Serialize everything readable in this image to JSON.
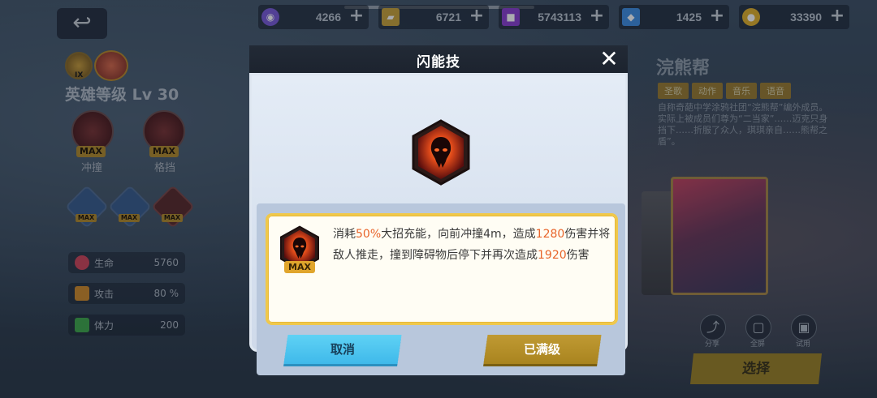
{
  "top_bar": {
    "resources": [
      {
        "icon": "purple-orb-icon",
        "value": "4266",
        "color": "#7a5bd8"
      },
      {
        "icon": "ticket-icon",
        "value": "6721",
        "color": "#c9a33a"
      },
      {
        "icon": "purple-cube-icon",
        "value": "5743113",
        "color": "#8a3fd0"
      },
      {
        "icon": "blue-gem-icon",
        "value": "1425",
        "color": "#3f8ee0"
      },
      {
        "icon": "gold-coin-icon",
        "value": "33390",
        "color": "#e0b02a"
      }
    ]
  },
  "left_panel": {
    "badge_rank": "IX",
    "hero_level": "英雄等级 Lv 30",
    "skills": [
      {
        "name": "冲撞",
        "badge": "MAX"
      },
      {
        "name": "格挡",
        "badge": "MAX"
      }
    ],
    "small_skills": [
      {
        "badge": "MAX"
      },
      {
        "badge": "MAX"
      },
      {
        "badge": "MAX"
      }
    ],
    "stats": [
      {
        "label": "生命",
        "value": "5760",
        "icon": "heart-icon",
        "color": "#d0455a"
      },
      {
        "label": "攻击",
        "value": "80 %",
        "icon": "burst-icon",
        "color": "#d08a2a"
      },
      {
        "label": "体力",
        "value": "200",
        "icon": "lightning-icon",
        "color": "#3fa84a"
      }
    ]
  },
  "right_panel": {
    "hero_name": "浣熊帮",
    "tags": [
      "圣歌",
      "动作",
      "音乐",
      "语音"
    ],
    "bio": "自称奇葩中学涂鸦社团“浣熊帮”编外成员。实际上被成员们尊为“二当家”……迈克只身挡下……折服了众人，琪琪亲自……熊帮之盾”。",
    "controls": [
      {
        "label": "分享",
        "icon": "share-icon"
      },
      {
        "label": "全屏",
        "icon": "fullscreen-icon"
      },
      {
        "label": "试用",
        "icon": "gamepad-icon"
      }
    ],
    "select_label": "选择"
  },
  "modal": {
    "title": "闪能技",
    "close_glyph": "✕",
    "skill_badge": "MAX",
    "description": {
      "p1": "消耗",
      "h1": "50%",
      "p2": "大招充能，向前冲撞4m，造成",
      "h2": "1280",
      "p3": "伤害并将敌人推走，撞到障碍物后停下并再次造成",
      "h3": "1920",
      "p4": "伤害"
    },
    "cancel_label": "取消",
    "maxed_label": "已满级",
    "highlight_color": "#e8642a"
  }
}
